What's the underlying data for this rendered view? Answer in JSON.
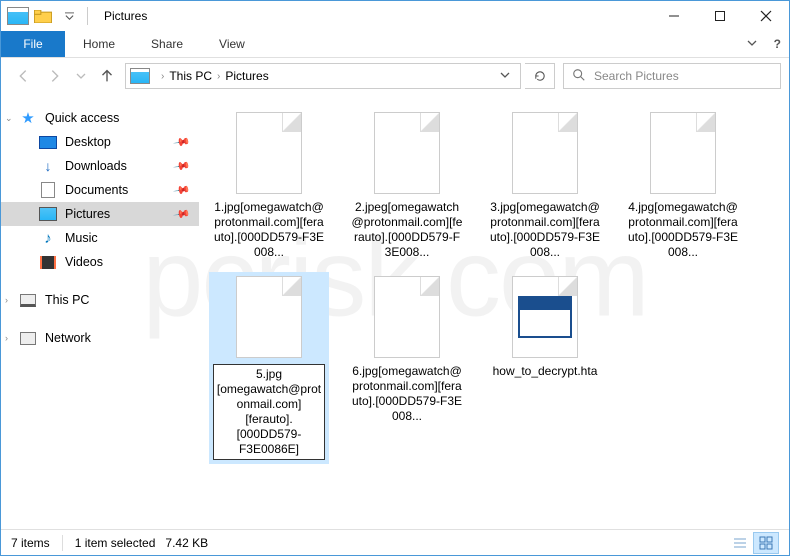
{
  "window": {
    "title": "Pictures"
  },
  "ribbon": {
    "file": "File",
    "tabs": [
      "Home",
      "Share",
      "View"
    ]
  },
  "breadcrumb": {
    "root": "This PC",
    "current": "Pictures"
  },
  "search": {
    "placeholder": "Search Pictures"
  },
  "sidebar": {
    "quick_access": "Quick access",
    "items": [
      {
        "label": "Desktop",
        "pinned": true
      },
      {
        "label": "Downloads",
        "pinned": true
      },
      {
        "label": "Documents",
        "pinned": true
      },
      {
        "label": "Pictures",
        "pinned": true,
        "selected": true
      },
      {
        "label": "Music",
        "pinned": false
      },
      {
        "label": "Videos",
        "pinned": false
      }
    ],
    "this_pc": "This PC",
    "network": "Network"
  },
  "files": [
    {
      "label": "1.jpg[omegawatch@protonmail.com][ferauto].[000DD579-F3E008...",
      "type": "file"
    },
    {
      "label": "2.jpeg[omegawatch@protonmail.com][ferauto].[000DD579-F3E008...",
      "type": "file"
    },
    {
      "label": "3.jpg[omegawatch@protonmail.com][ferauto].[000DD579-F3E008...",
      "type": "file"
    },
    {
      "label": "4.jpg[omegawatch@protonmail.com][ferauto].[000DD579-F3E008...",
      "type": "file"
    },
    {
      "label": "5.jpg\n[omegawatch@protonmail.com]\n[ferauto].\n[000DD579-\nF3E0086E]",
      "type": "file",
      "selected": true,
      "full": true
    },
    {
      "label": "6.jpg[omegawatch@protonmail.com][ferauto].[000DD579-F3E008...",
      "type": "file"
    },
    {
      "label": "how_to_decrypt.hta",
      "type": "hta"
    }
  ],
  "statusbar": {
    "count": "7 items",
    "selected": "1 item selected",
    "size": "7.42 KB"
  },
  "watermark": "pcrisk.com"
}
